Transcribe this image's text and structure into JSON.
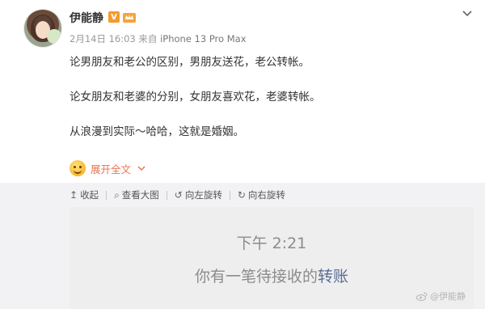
{
  "post": {
    "author": "伊能静",
    "badge": "V",
    "date": "2月14日 16:03",
    "source_prefix": "来自",
    "source": "iPhone 13 Pro Max",
    "lines": [
      "论男朋友和老公的区别，男朋友送花，老公转帐。",
      "论女朋友和老婆的分别，女朋友喜欢花，老婆转帐。",
      "从浪漫到实际～哈哈，这就是婚姻。"
    ],
    "expand_label": "展开全文"
  },
  "toolbar": {
    "collapse": "收起",
    "view_large": "查看大图",
    "rotate_left": "向左旋转",
    "rotate_right": "向右旋转"
  },
  "screenshot": {
    "time": "下午 2:21",
    "message_prefix": "你有一笔待接收的",
    "message_link": "转账"
  },
  "watermark": "@伊能静",
  "colors": {
    "accent": "#eb7350",
    "verified": "#f59b2b",
    "link": "#5a6d96",
    "panel": "#f2f2f5"
  },
  "icons": [
    "avatar",
    "verified-badge-icon",
    "crown-icon",
    "chevron-down-icon",
    "smile-emoji-icon",
    "collapse-arrow-icon",
    "magnifier-icon",
    "rotate-left-icon",
    "rotate-right-icon",
    "weibo-logo-icon"
  ]
}
